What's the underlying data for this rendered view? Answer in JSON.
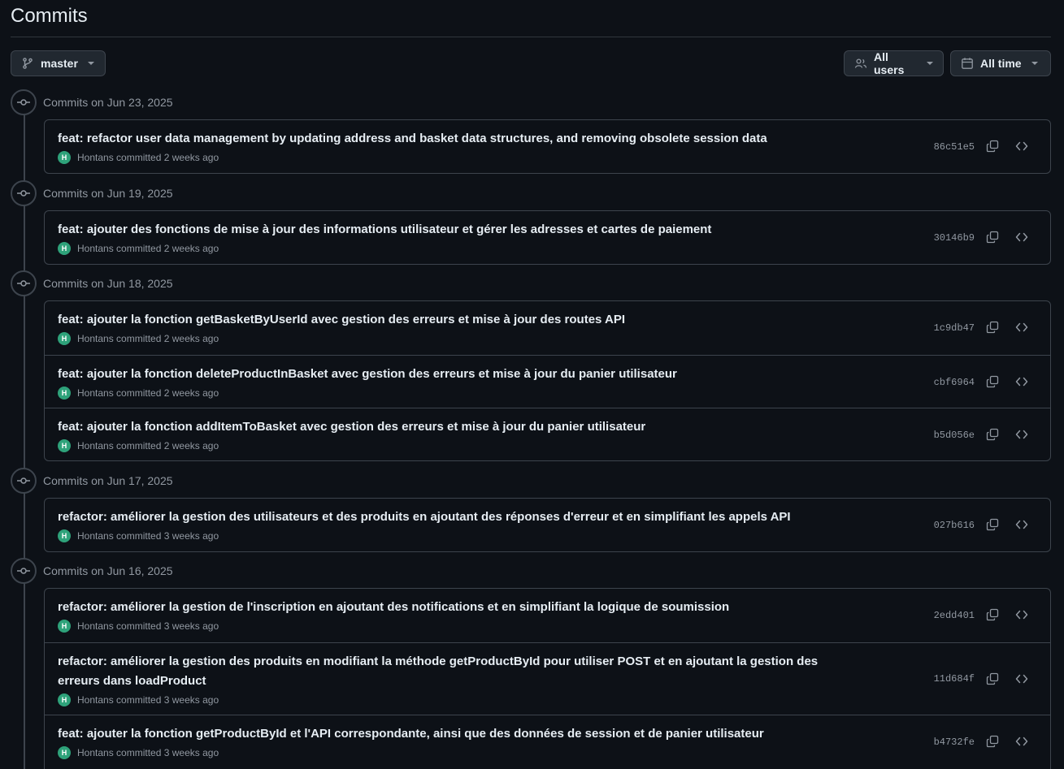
{
  "page": {
    "title": "Commits"
  },
  "toolbar": {
    "branch": "master",
    "users": "All users",
    "time": "All time"
  },
  "groups": [
    {
      "date": "Commits on Jun 23, 2025",
      "commits": [
        {
          "message": "feat: refactor user data management by updating address and basket data structures, and removing obsolete session data",
          "author": "Hontans",
          "verb": "committed",
          "ago": "2 weeks ago",
          "sha": "86c51e5"
        }
      ]
    },
    {
      "date": "Commits on Jun 19, 2025",
      "commits": [
        {
          "message": "feat: ajouter des fonctions de mise à jour des informations utilisateur et gérer les adresses et cartes de paiement",
          "author": "Hontans",
          "verb": "committed",
          "ago": "2 weeks ago",
          "sha": "30146b9"
        }
      ]
    },
    {
      "date": "Commits on Jun 18, 2025",
      "commits": [
        {
          "message": "feat: ajouter la fonction getBasketByUserId avec gestion des erreurs et mise à jour des routes API",
          "author": "Hontans",
          "verb": "committed",
          "ago": "2 weeks ago",
          "sha": "1c9db47"
        },
        {
          "message": "feat: ajouter la fonction deleteProductInBasket avec gestion des erreurs et mise à jour du panier utilisateur",
          "author": "Hontans",
          "verb": "committed",
          "ago": "2 weeks ago",
          "sha": "cbf6964"
        },
        {
          "message": "feat: ajouter la fonction addItemToBasket avec gestion des erreurs et mise à jour du panier utilisateur",
          "author": "Hontans",
          "verb": "committed",
          "ago": "2 weeks ago",
          "sha": "b5d056e"
        }
      ]
    },
    {
      "date": "Commits on Jun 17, 2025",
      "commits": [
        {
          "message": "refactor: améliorer la gestion des utilisateurs et des produits en ajoutant des réponses d'erreur et en simplifiant les appels API",
          "author": "Hontans",
          "verb": "committed",
          "ago": "3 weeks ago",
          "sha": "027b616"
        }
      ]
    },
    {
      "date": "Commits on Jun 16, 2025",
      "commits": [
        {
          "message": "refactor: améliorer la gestion de l'inscription en ajoutant des notifications et en simplifiant la logique de soumission",
          "author": "Hontans",
          "verb": "committed",
          "ago": "3 weeks ago",
          "sha": "2edd401"
        },
        {
          "message": "refactor: améliorer la gestion des produits en modifiant la méthode getProductById pour utiliser POST et en ajoutant la gestion des erreurs dans loadProduct",
          "author": "Hontans",
          "verb": "committed",
          "ago": "3 weeks ago",
          "sha": "11d684f"
        },
        {
          "message": "feat: ajouter la fonction getProductById et l'API correspondante, ainsi que des données de session et de panier utilisateur",
          "author": "Hontans",
          "verb": "committed",
          "ago": "3 weeks ago",
          "sha": "b4732fe"
        }
      ]
    }
  ],
  "colors": {
    "background": "#0d1117",
    "border": "#3d444d",
    "text": "#e6edf3",
    "muted": "#9198a1",
    "avatar": "#2ea27a"
  },
  "icons": [
    "git-branch-icon",
    "people-icon",
    "calendar-icon",
    "git-commit-icon",
    "copy-icon",
    "code-icon"
  ]
}
